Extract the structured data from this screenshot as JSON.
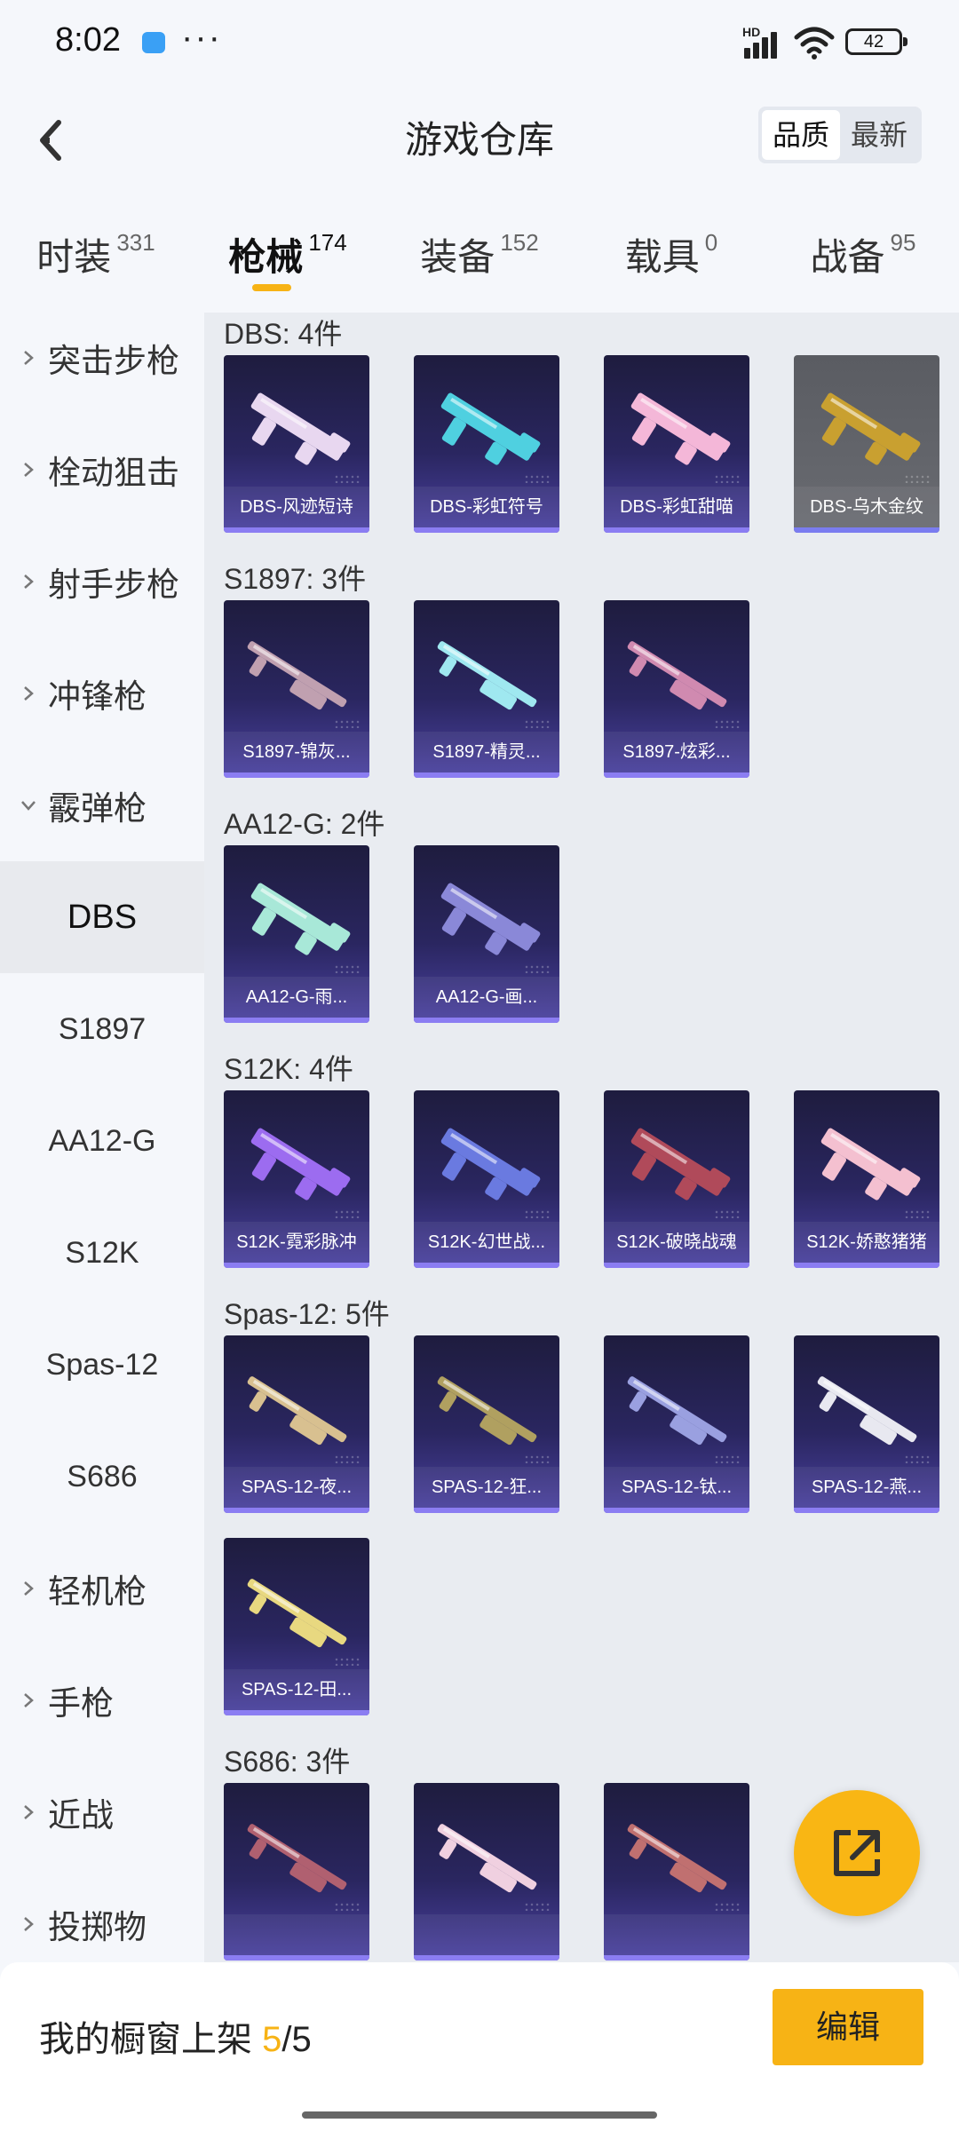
{
  "status": {
    "time": "8:02",
    "dots": "···",
    "hd": "HD",
    "battery": "42"
  },
  "header": {
    "title": "游戏仓库",
    "sort": [
      {
        "label": "品质",
        "active": true
      },
      {
        "label": "最新",
        "active": false
      }
    ]
  },
  "tabs": [
    {
      "label": "时装",
      "count": "331"
    },
    {
      "label": "枪械",
      "count": "174",
      "active": true
    },
    {
      "label": "装备",
      "count": "152"
    },
    {
      "label": "载具",
      "count": "0"
    },
    {
      "label": "战备",
      "count": "95"
    }
  ],
  "sidebar": [
    {
      "type": "category",
      "label": "突击步枪",
      "expanded": false
    },
    {
      "type": "category",
      "label": "栓动狙击",
      "expanded": false
    },
    {
      "type": "category",
      "label": "射手步枪",
      "expanded": false
    },
    {
      "type": "category",
      "label": "冲锋枪",
      "expanded": false
    },
    {
      "type": "category",
      "label": "霰弹枪",
      "expanded": true
    },
    {
      "type": "sub",
      "label": "DBS",
      "selected": true
    },
    {
      "type": "sub",
      "label": "S1897"
    },
    {
      "type": "sub",
      "label": "AA12-G"
    },
    {
      "type": "sub",
      "label": "S12K"
    },
    {
      "type": "sub",
      "label": "Spas-12"
    },
    {
      "type": "sub",
      "label": "S686"
    },
    {
      "type": "category",
      "label": "轻机枪",
      "expanded": false
    },
    {
      "type": "category",
      "label": "手枪",
      "expanded": false
    },
    {
      "type": "category",
      "label": "近战",
      "expanded": false
    },
    {
      "type": "category",
      "label": "投掷物",
      "expanded": false
    }
  ],
  "groups": [
    {
      "title": "DBS: 4件",
      "items": [
        {
          "name": "DBS-风迹短诗",
          "accent": "#e8d7f0"
        },
        {
          "name": "DBS-彩虹符号",
          "accent": "#4fd0e0"
        },
        {
          "name": "DBS-彩虹甜喵",
          "accent": "#f4b7d8"
        },
        {
          "name": "DBS-乌木金纹",
          "accent": "#c9a030",
          "grey": true
        }
      ]
    },
    {
      "title": "S1897: 3件",
      "items": [
        {
          "name": "S1897-锦灰...",
          "accent": "#c0a0b0"
        },
        {
          "name": "S1897-精灵...",
          "accent": "#9fe8f0"
        },
        {
          "name": "S1897-炫彩...",
          "accent": "#d08ab0"
        }
      ]
    },
    {
      "title": "AA12-G: 2件",
      "items": [
        {
          "name": "AA12-G-雨...",
          "accent": "#a8e8d8"
        },
        {
          "name": "AA12-G-画...",
          "accent": "#8a88d8"
        }
      ]
    },
    {
      "title": "S12K: 4件",
      "items": [
        {
          "name": "S12K-霓彩脉冲",
          "accent": "#9c6cf0"
        },
        {
          "name": "S12K-幻世战...",
          "accent": "#6a7ae0"
        },
        {
          "name": "S12K-破晓战魂",
          "accent": "#b04a5a"
        },
        {
          "name": "S12K-娇憨猪猪",
          "accent": "#f4c0d0"
        }
      ]
    },
    {
      "title": "Spas-12: 5件",
      "items": [
        {
          "name": "SPAS-12-夜...",
          "accent": "#d8c090"
        },
        {
          "name": "SPAS-12-狂...",
          "accent": "#b0a060"
        },
        {
          "name": "SPAS-12-钛...",
          "accent": "#9aa0e0"
        },
        {
          "name": "SPAS-12-燕...",
          "accent": "#e8e8f0"
        },
        {
          "name": "SPAS-12-田...",
          "accent": "#e8d880"
        }
      ]
    },
    {
      "title": "S686: 3件",
      "items": [
        {
          "name": "",
          "accent": "#b06070"
        },
        {
          "name": "",
          "accent": "#f0d0e0"
        },
        {
          "name": "",
          "accent": "#c07070"
        }
      ]
    }
  ],
  "bottom": {
    "label": "我的橱窗上架",
    "current": "5",
    "separator": "/",
    "total": "5",
    "edit": "编辑"
  },
  "colors": {
    "accent": "#f7b315",
    "card_bottom": "#8b7df2"
  }
}
